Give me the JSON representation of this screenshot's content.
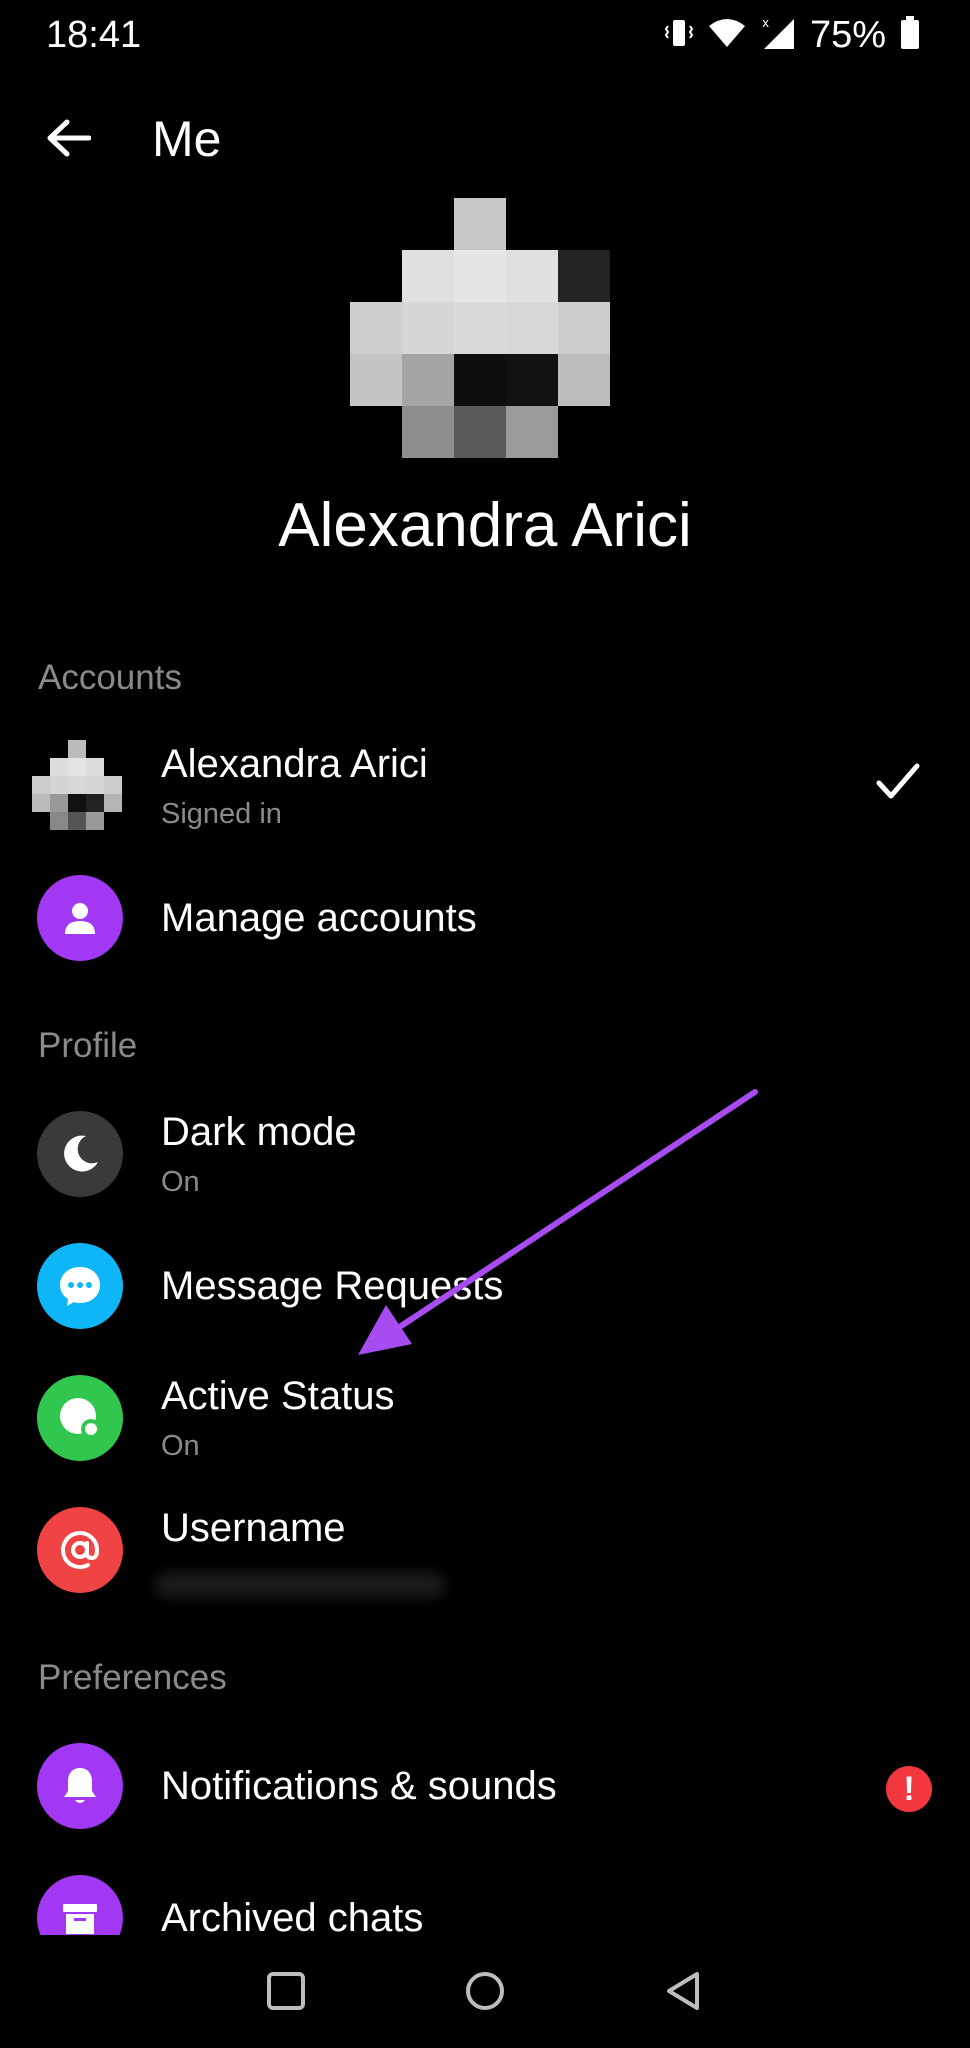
{
  "status_bar": {
    "time": "18:41",
    "battery": "75%",
    "icons": [
      "vibrate-icon",
      "wifi-icon",
      "signal-icon",
      "battery-icon"
    ]
  },
  "header": {
    "title": "Me",
    "back_icon": "arrow-left-icon"
  },
  "profile": {
    "name": "Alexandra Arici"
  },
  "sections": {
    "accounts": "Accounts",
    "profile": "Profile",
    "preferences": "Preferences"
  },
  "accounts": {
    "current": {
      "name": "Alexandra Arici",
      "status": "Signed in",
      "selected_icon": "checkmark-icon"
    },
    "manage": {
      "label": "Manage accounts",
      "icon": "person-icon",
      "color": "#a338f4"
    }
  },
  "profile_items": [
    {
      "label": "Dark mode",
      "sub": "On",
      "icon": "moon-icon",
      "color": "#3a3a3c"
    },
    {
      "label": "Message Requests",
      "icon": "chat-bubble-icon",
      "color": "#0fb6f7"
    },
    {
      "label": "Active Status",
      "sub": "On",
      "icon": "active-status-icon",
      "color": "#31c74f"
    },
    {
      "label": "Username",
      "icon": "at-icon",
      "color": "#f04343"
    }
  ],
  "preference_items": [
    {
      "label": "Notifications & sounds",
      "icon": "bell-icon",
      "color": "#a338f4",
      "badge": "!"
    },
    {
      "label": "Archived chats",
      "icon": "archive-icon",
      "color": "#a338f4"
    }
  ],
  "nav": {
    "recents": "square-icon",
    "home": "circle-icon",
    "back": "triangle-back-icon"
  },
  "annotation": {
    "color": "#a64cf0"
  }
}
